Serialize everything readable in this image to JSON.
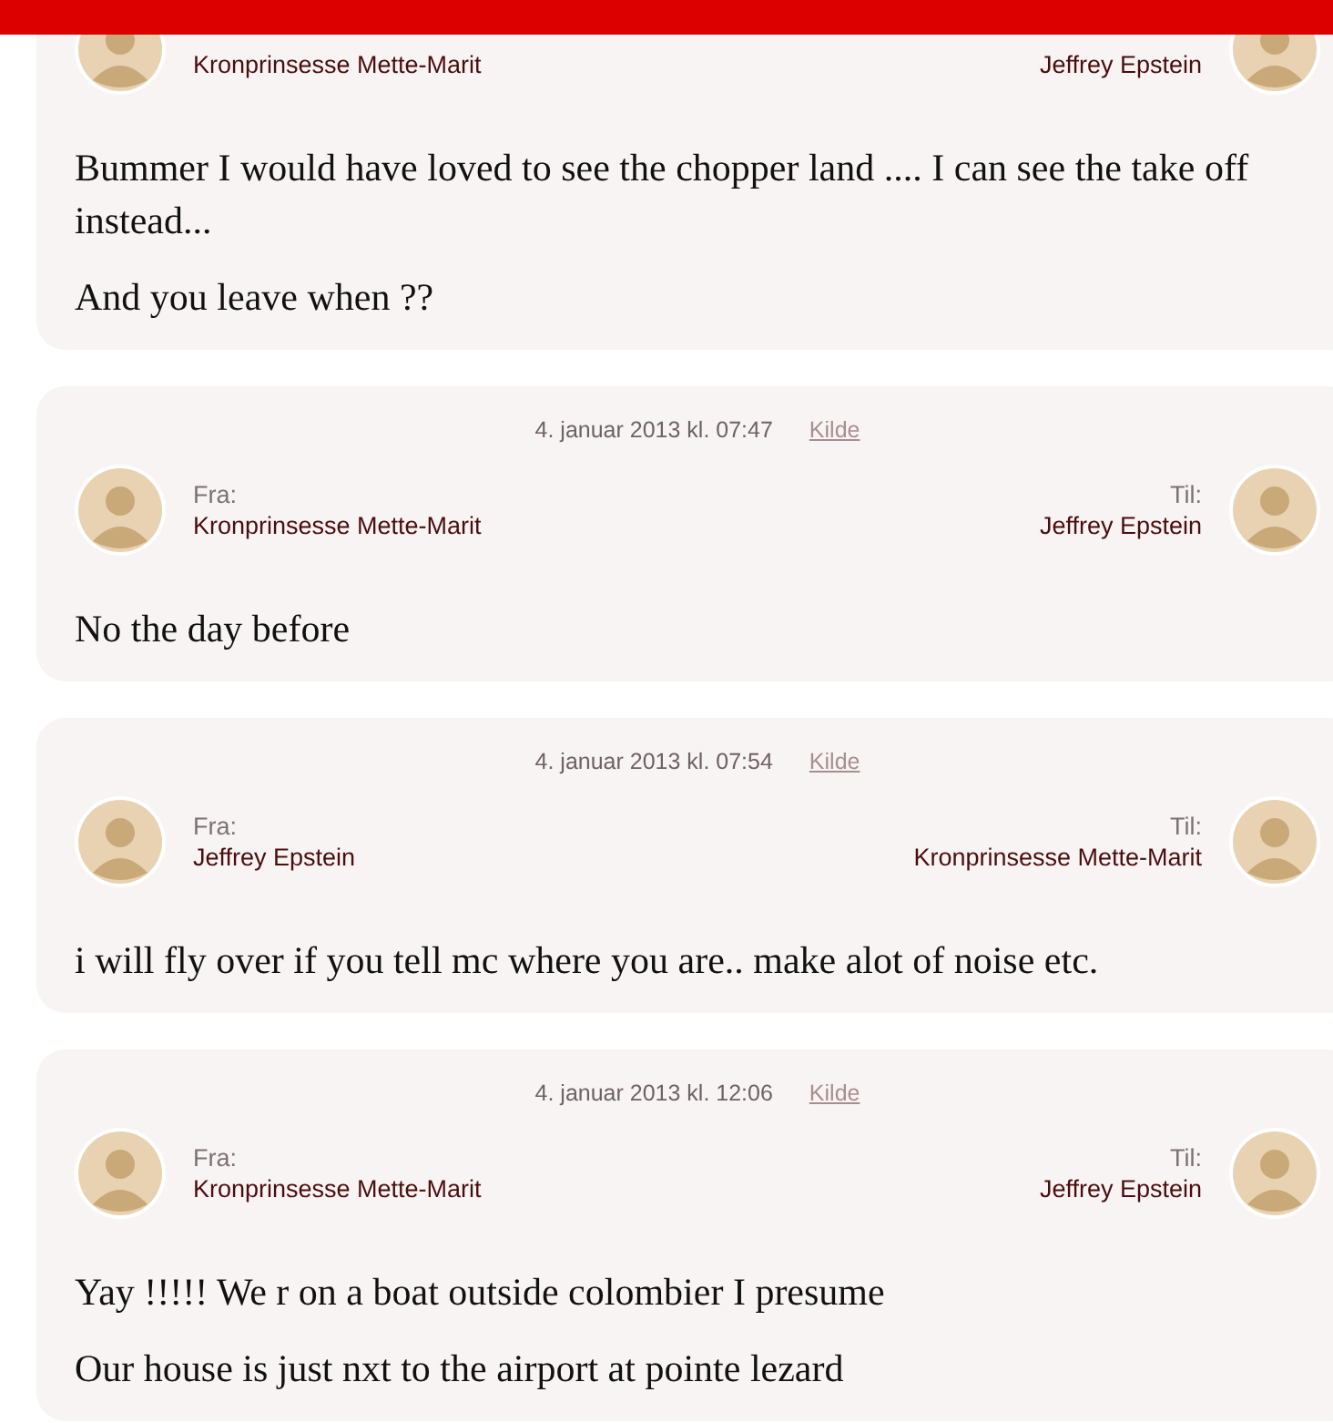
{
  "messages": [
    {
      "from": {
        "name": "Kronprinsesse Mette-Marit"
      },
      "to": {
        "name": "Jeffrey Epstein"
      },
      "paragraphs": [
        "Bummer I would have loved to see the chopper land .... I can see the take off instead...",
        "And you leave when ??"
      ]
    },
    {
      "date": "4. januar 2013 kl. 07:47",
      "source_link": "Kilde",
      "from_label": "Fra:",
      "to_label": "Til:",
      "from": {
        "name": "Kronprinsesse Mette-Marit"
      },
      "to": {
        "name": "Jeffrey Epstein"
      },
      "paragraphs": [
        "No the day before"
      ]
    },
    {
      "date": "4. januar 2013 kl. 07:54",
      "source_link": "Kilde",
      "from_label": "Fra:",
      "to_label": "Til:",
      "from": {
        "name": "Jeffrey Epstein"
      },
      "to": {
        "name": "Kronprinsesse Mette-Marit"
      },
      "paragraphs": [
        "i will fly over if you tell mc where you are.. make alot of noise etc."
      ]
    },
    {
      "date": "4. januar 2013 kl. 12:06",
      "source_link": "Kilde",
      "from_label": "Fra:",
      "to_label": "Til:",
      "from": {
        "name": "Kronprinsesse Mette-Marit"
      },
      "to": {
        "name": "Jeffrey Epstein"
      },
      "paragraphs": [
        "Yay !!!!! We r on a boat outside colombier I presume",
        "Our house is just nxt to the airport at pointe lezard"
      ]
    }
  ]
}
